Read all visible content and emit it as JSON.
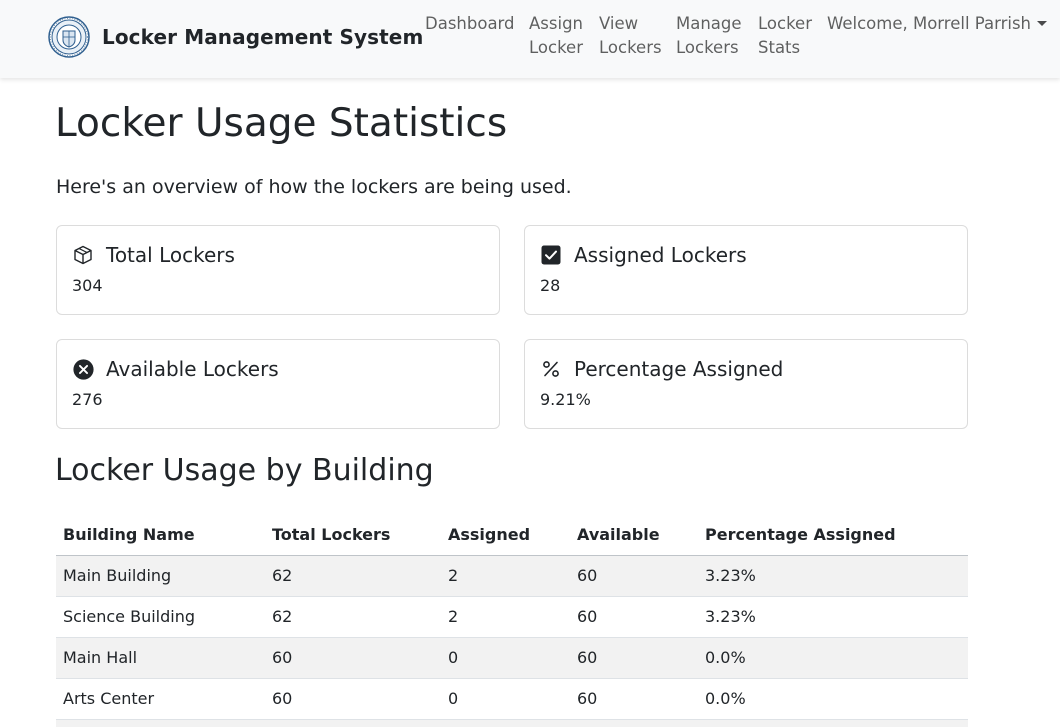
{
  "nav": {
    "brand": "Locker Management System",
    "links": [
      {
        "label_line1": "Dashboard",
        "label_line2": ""
      },
      {
        "label_line1": "Assign",
        "label_line2": "Locker"
      },
      {
        "label_line1": "View",
        "label_line2": "Lockers"
      },
      {
        "label_line1": "Manage",
        "label_line2": "Lockers"
      },
      {
        "label_line1": "Locker",
        "label_line2": "Stats"
      }
    ],
    "user": "Welcome, Morrell Parrish"
  },
  "page": {
    "title": "Locker Usage Statistics",
    "intro": "Here's an overview of how the lockers are being used."
  },
  "stats": [
    {
      "icon": "box-icon",
      "label": "Total Lockers",
      "value": "304"
    },
    {
      "icon": "check-square-icon",
      "label": "Assigned Lockers",
      "value": "28"
    },
    {
      "icon": "x-circle-icon",
      "label": "Available Lockers",
      "value": "276"
    },
    {
      "icon": "percent-icon",
      "label": "Percentage Assigned",
      "value": "9.21%"
    }
  ],
  "building_section": {
    "title": "Locker Usage by Building",
    "columns": [
      "Building Name",
      "Total Lockers",
      "Assigned",
      "Available",
      "Percentage Assigned"
    ],
    "rows": [
      [
        "Main Building",
        "62",
        "2",
        "60",
        "3.23%"
      ],
      [
        "Science Building",
        "62",
        "2",
        "60",
        "3.23%"
      ],
      [
        "Main Hall",
        "60",
        "0",
        "60",
        "0.0%"
      ],
      [
        "Arts Center",
        "60",
        "0",
        "60",
        "0.0%"
      ],
      [
        "",
        "",
        "",
        "",
        ""
      ]
    ]
  },
  "colors": {
    "navbar_bg": "#f8f9fa",
    "text": "#212529",
    "stripe": "#f2f2f2",
    "logo_blue": "#2f5f8f"
  }
}
